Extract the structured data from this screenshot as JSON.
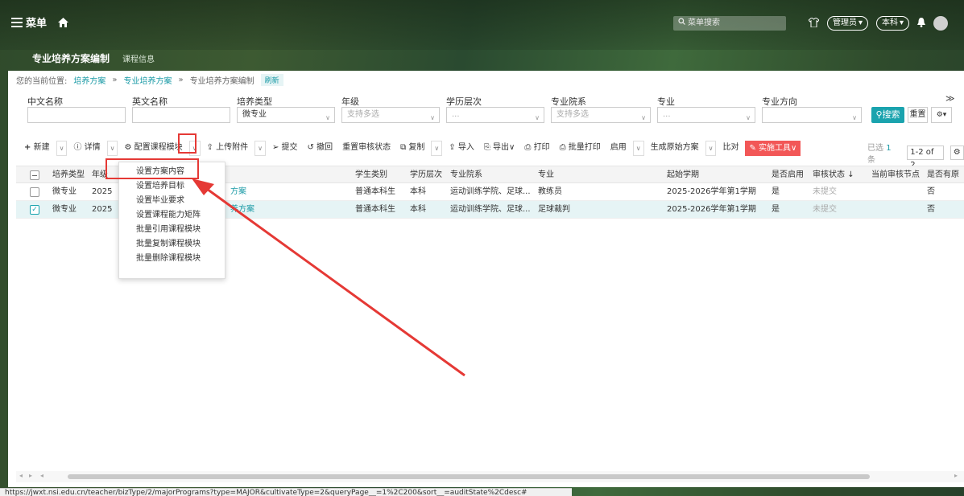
{
  "topbar": {
    "menu_label": "菜单",
    "search_placeholder": "菜单搜索",
    "role_label": "管理员",
    "level_label": "本科"
  },
  "tabs": [
    {
      "label": "专业培养方案编制",
      "active": true
    },
    {
      "label": "课程信息",
      "active": false
    }
  ],
  "breadcrumb": {
    "prefix": "您的当前位置:",
    "items": [
      "培养方案",
      "专业培养方案",
      "专业培养方案编制"
    ],
    "separator": "»",
    "refresh": "刷新"
  },
  "filters": {
    "labels": [
      "中文名称",
      "英文名称",
      "培养类型",
      "年级",
      "学历层次",
      "专业院系",
      "专业",
      "专业方向"
    ],
    "training_type_value": "微专业",
    "grade_placeholder": "支持多选",
    "edu_level_placeholder": "...",
    "dept_placeholder": "支持多选",
    "major_placeholder": "...",
    "search_label": "搜索",
    "reset_label": "重置"
  },
  "toolbar": {
    "new": "新建",
    "detail": "详情",
    "config_module": "配置课程模块",
    "upload": "上传附件",
    "submit": "提交",
    "revoke": "撤回",
    "reset_audit": "重置审核状态",
    "copy": "复制",
    "import": "导入",
    "export": "导出",
    "print": "打印",
    "batch_print": "批量打印",
    "enable": "启用",
    "gen_original": "生成原始方案",
    "compare": "比对",
    "impl_tools": "实施工具"
  },
  "selection": {
    "prefix": "已选",
    "count": "1",
    "suffix": "条",
    "pager": "1-2 of 2"
  },
  "table": {
    "headers": [
      "培养类型",
      "年级",
      "学生类别",
      "学历层次",
      "专业院系",
      "专业",
      "起始学期",
      "是否启用",
      "审核状态",
      "当前审核节点",
      "是否有原"
    ],
    "rows": [
      {
        "type": "微专业",
        "grade": "2025",
        "name_frag": "方案",
        "student": "普通本科生",
        "level": "本科",
        "dept": "运动训练学院、足球...",
        "major": "教练员",
        "term": "2025-2026学年第1学期",
        "enabled": "是",
        "audit": "未提交",
        "node": "",
        "orig": "否",
        "checked": false
      },
      {
        "type": "微专业",
        "grade": "2025",
        "name_frag": "养方案",
        "student": "普通本科生",
        "level": "本科",
        "dept": "运动训练学院、足球...",
        "major": "足球裁判",
        "term": "2025-2026学年第1学期",
        "enabled": "是",
        "audit": "未提交",
        "node": "",
        "orig": "否",
        "checked": true
      }
    ]
  },
  "dropdown": {
    "items": [
      "设置方案内容",
      "设置培养目标",
      "设置毕业要求",
      "设置课程能力矩阵",
      "批量引用课程模块",
      "批量复制课程模块",
      "批量删除课程模块"
    ]
  },
  "status_url": "https://jwxt.nsi.edu.cn/teacher/bizType/2/majorPrograms?type=MAJOR&cultivateType=2&queryPage__=1%2C200&sort__=auditState%2Cdesc#",
  "colors": {
    "accent": "#1aa3ae",
    "danger": "#f25757",
    "highlight": "#e53935"
  }
}
